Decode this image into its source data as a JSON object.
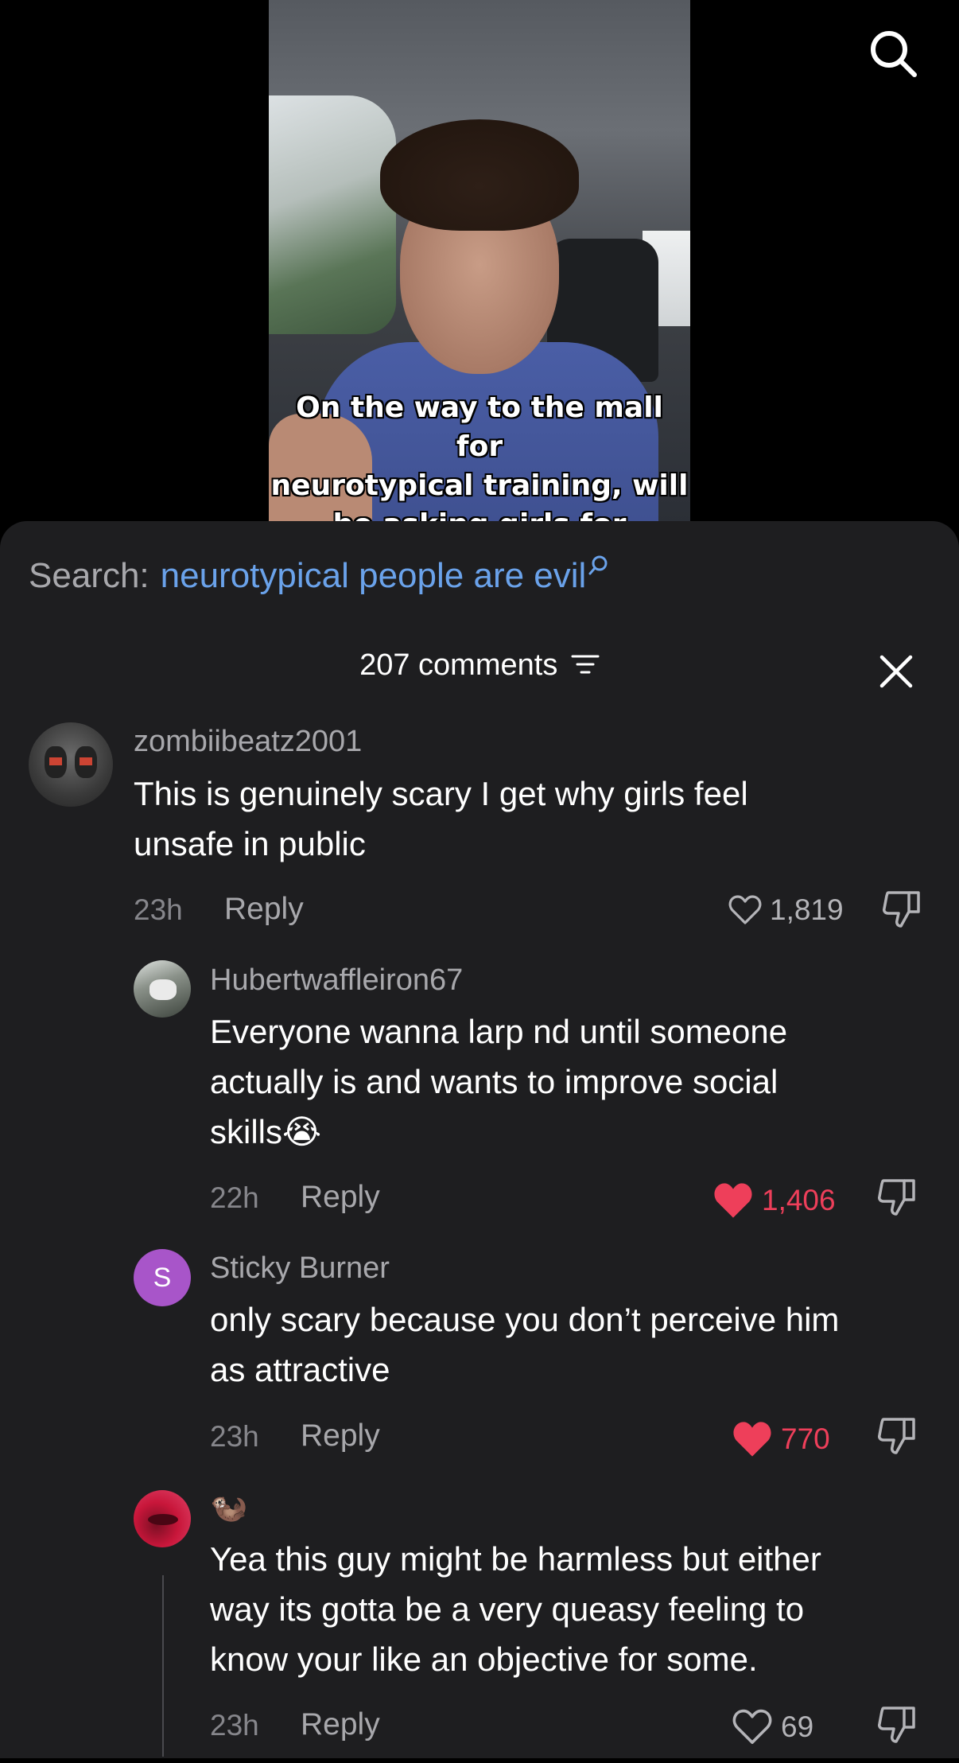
{
  "video": {
    "caption": "On the way to the mall for\nneurotypical training, will\nbe asking girls for\ndirections"
  },
  "search": {
    "label": "Search:",
    "query": "neurotypical people are evil"
  },
  "comments_header": {
    "label": "207 comments"
  },
  "comments": [
    {
      "username": "zombiibeatz2001",
      "text_line1": "This is genuinely scary I get why girls feel",
      "text_line2": "unsafe in public",
      "time": "23h",
      "reply_label": "Reply",
      "likes": "1,819",
      "liked": false
    },
    {
      "username": "Hubertwaffleiron67",
      "text_line1": "Everyone wanna larp nd until someone",
      "text_line2": "actually is and wants to improve social",
      "text_line3": "skills",
      "emoji": "😭",
      "time": "22h",
      "reply_label": "Reply",
      "likes": "1,406",
      "liked": true
    },
    {
      "username": "Sticky Burner",
      "avatar_letter": "S",
      "text_line1": "only scary because you don’t perceive him",
      "text_line2": "as attractive",
      "time": "23h",
      "reply_label": "Reply",
      "likes": "770",
      "liked": true
    },
    {
      "username": "🦦",
      "text_line1": "Yea this guy might be harmless but either",
      "text_line2": "way its gotta be a very queasy feeling to",
      "text_line3": "know your like an objective for some.",
      "time": "23h",
      "reply_label": "Reply",
      "likes": "69",
      "liked": false
    }
  ],
  "colors": {
    "sheet_bg": "#1e1e20",
    "link_blue": "#6aa2ea",
    "like_red": "#ee3f5a",
    "avatar_purple": "#a855c9"
  },
  "icons": {
    "top_search": "search-icon",
    "search_mini": "search-icon",
    "filter": "filter-icon",
    "close": "close-icon",
    "like": "heart-icon",
    "dislike": "thumbs-down-icon"
  }
}
